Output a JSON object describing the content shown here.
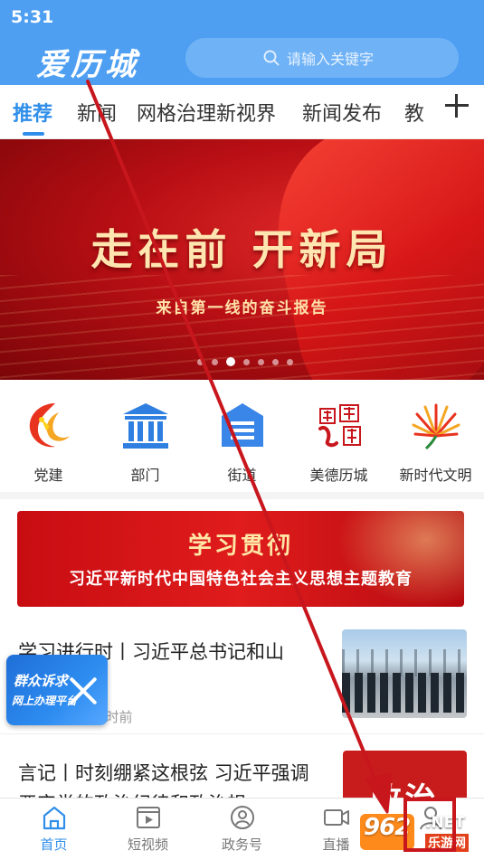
{
  "status_bar": {
    "time": "5:31"
  },
  "header": {
    "logo": "爱历城",
    "search_placeholder": "请输入关键字"
  },
  "tabs": [
    {
      "label": "推荐",
      "active": true
    },
    {
      "label": "新闻"
    },
    {
      "label": "网格治理新视界"
    },
    {
      "label": "新闻发布"
    },
    {
      "label": "教"
    }
  ],
  "banner": {
    "title": "走在前 开新局",
    "subtitle": "来自第一线的奋斗报告",
    "dot_count": 7,
    "active_dot": 2
  },
  "quick_links": [
    {
      "label": "党建",
      "icon": "party-building-icon"
    },
    {
      "label": "部门",
      "icon": "government-building-icon"
    },
    {
      "label": "街道",
      "icon": "street-list-icon"
    },
    {
      "label": "美德历城",
      "icon": "virtue-licheng-icon"
    },
    {
      "label": "新时代文明",
      "icon": "new-era-civilization-icon"
    }
  ],
  "study_banner": {
    "title": "学习贯彻",
    "subtitle": "习近平新时代中国特色社会主义思想主题教育"
  },
  "news": [
    {
      "title": "学习进行时丨习近平总书记和山",
      "meta": "1小时前"
    },
    {
      "title": "言记丨时刻绷紧这根弦  习近平强调严守党的政治纪律和政治规",
      "thumb_text": "政治"
    }
  ],
  "floating_card": {
    "line1": "群众诉求",
    "line2": "网上办理平台"
  },
  "bottom_nav": [
    {
      "label": "首页",
      "icon": "home-icon",
      "active": true
    },
    {
      "label": "短视频",
      "icon": "short-video-icon"
    },
    {
      "label": "政务号",
      "icon": "government-account-icon"
    },
    {
      "label": "直播",
      "icon": "live-camera-icon"
    },
    {
      "label": "",
      "icon": "profile-icon"
    }
  ],
  "watermark": {
    "brand": "962",
    "net": ".NET",
    "sub": "乐游网"
  },
  "colors": {
    "header_blue": "#4e9ff2",
    "accent_blue": "#2f8ee9",
    "party_red": "#c8161d",
    "annotation_red": "#c8161d"
  }
}
